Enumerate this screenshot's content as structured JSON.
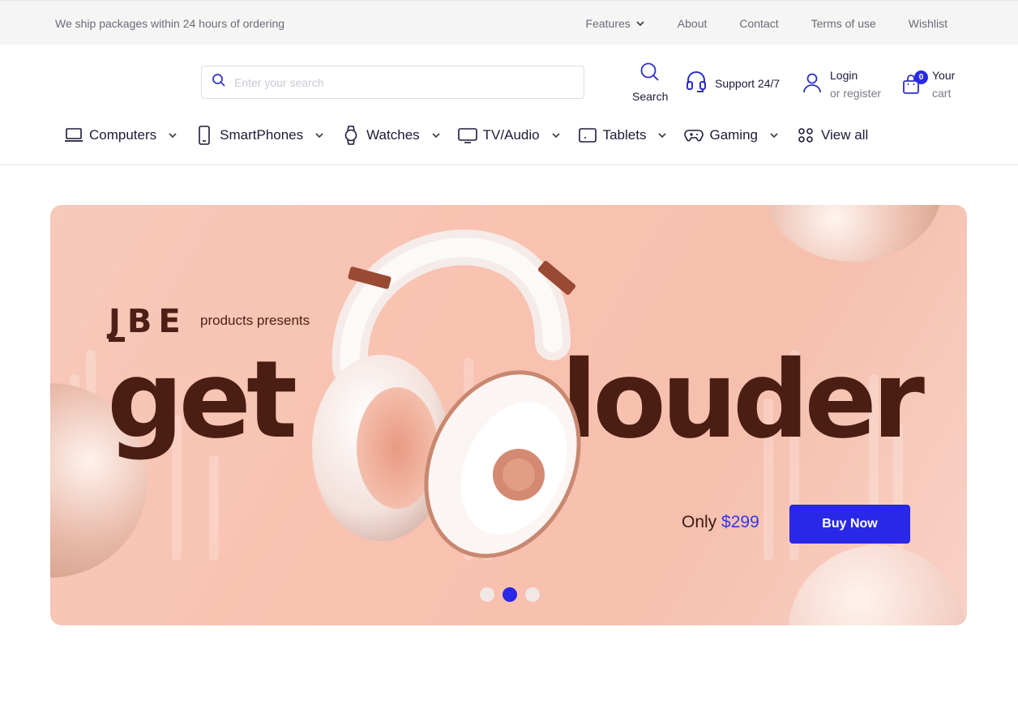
{
  "topbar": {
    "shipping_note": "We ship packages within 24 hours of ordering",
    "links": [
      "Features",
      "About",
      "Contact",
      "Terms of use",
      "Wishlist"
    ]
  },
  "header": {
    "search_placeholder": "Enter your search",
    "search_label": "Search",
    "support_label": "Support 24/7",
    "login_label": "Login",
    "login_sub": "or register",
    "cart_label": "Your",
    "cart_sub": "cart",
    "cart_count": "0"
  },
  "categories": [
    {
      "label": "Computers",
      "icon": "laptop-icon"
    },
    {
      "label": "SmartPhones",
      "icon": "smartphone-icon"
    },
    {
      "label": "Watches",
      "icon": "watch-icon"
    },
    {
      "label": "TV/Audio",
      "icon": "tv-icon"
    },
    {
      "label": "Tablets",
      "icon": "tablet-icon"
    },
    {
      "label": "Gaming",
      "icon": "gamepad-icon"
    },
    {
      "label": "View all",
      "icon": "grid-dots-icon"
    }
  ],
  "hero": {
    "brand": "JBE",
    "presents": "products presents",
    "headline_left": "get",
    "headline_right": "louder",
    "price_prefix": "Only",
    "price": "$299",
    "cta": "Buy Now",
    "slides": 3,
    "active_slide": 2
  },
  "colors": {
    "accent": "#2828e6",
    "hero_bg": "#f7c3b2",
    "headline": "#4a1e13"
  }
}
